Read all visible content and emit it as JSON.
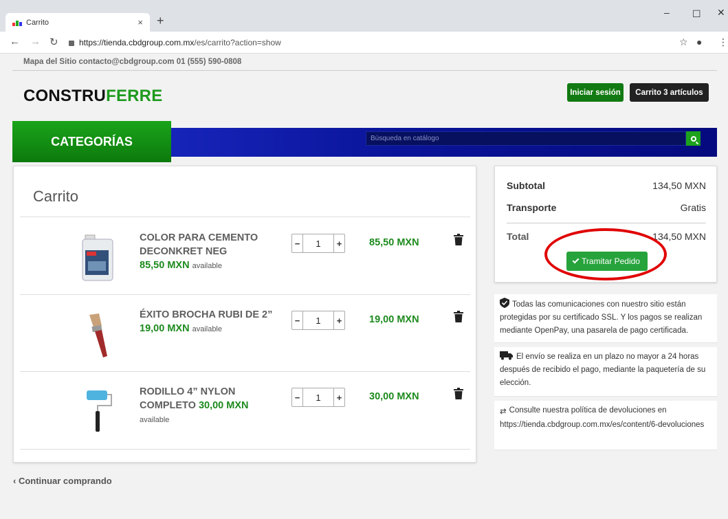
{
  "browser": {
    "tab_title": "Carrito",
    "url_host": "https://tienda.cbdgroup.com.mx",
    "url_path": "/es/carrito?action=show"
  },
  "header": {
    "topline": "Mapa del Sitio contacto@cbdgroup.com 01 (555) 590-0808",
    "logo_part1": "CONSTRU",
    "logo_part2": "FERRE",
    "login_label": "Iniciar sesión",
    "cart_label": "Carrito 3 artículos",
    "categories_label": "CATEGORÍAS",
    "search_placeholder": "Búsqueda en catálogo"
  },
  "cart": {
    "title": "Carrito",
    "items": [
      {
        "name": "COLOR PARA CEMENTO DECONKRET NEG",
        "price": "85,50 MXN",
        "availability": "available",
        "quantity": "1",
        "line_total": "85,50 MXN"
      },
      {
        "name": "ÉXITO BROCHA RUBI DE 2”",
        "price": "19,00 MXN",
        "availability": "available",
        "quantity": "1",
        "line_total": "19,00 MXN"
      },
      {
        "name": "RODILLO 4” NYLON COMPLETO",
        "price": "30,00 MXN",
        "availability": "available",
        "quantity": "1",
        "line_total": "30,00 MXN"
      }
    ]
  },
  "summary": {
    "subtotal_label": "Subtotal",
    "subtotal_value": "134,50 MXN",
    "shipping_label": "Transporte",
    "shipping_value": "Gratis",
    "total_label": "Total",
    "total_value": "134,50 MXN",
    "checkout_label": "Tramitar Pedido"
  },
  "info": {
    "security": "Todas las comunicaciones con nuestro sitio están protegidas por su certificado SSL. Y los pagos se realizan mediante OpenPay, una pasarela de pago certificada.",
    "shipping": "El envío se realiza en un plazo no mayor a 24 horas después de recibido el pago, mediante la paquetería de su elección.",
    "returns": "Consulte nuestra política de devoluciones en https://tienda.cbdgroup.com.mx/es/content/6-devoluciones"
  },
  "continue_label": "‹ Continuar comprando",
  "colors": {
    "accent_green": "#1d8a1d",
    "checkout_green": "#27a33c",
    "highlight_red": "#e00000",
    "nav_blue": "#0a1499"
  }
}
